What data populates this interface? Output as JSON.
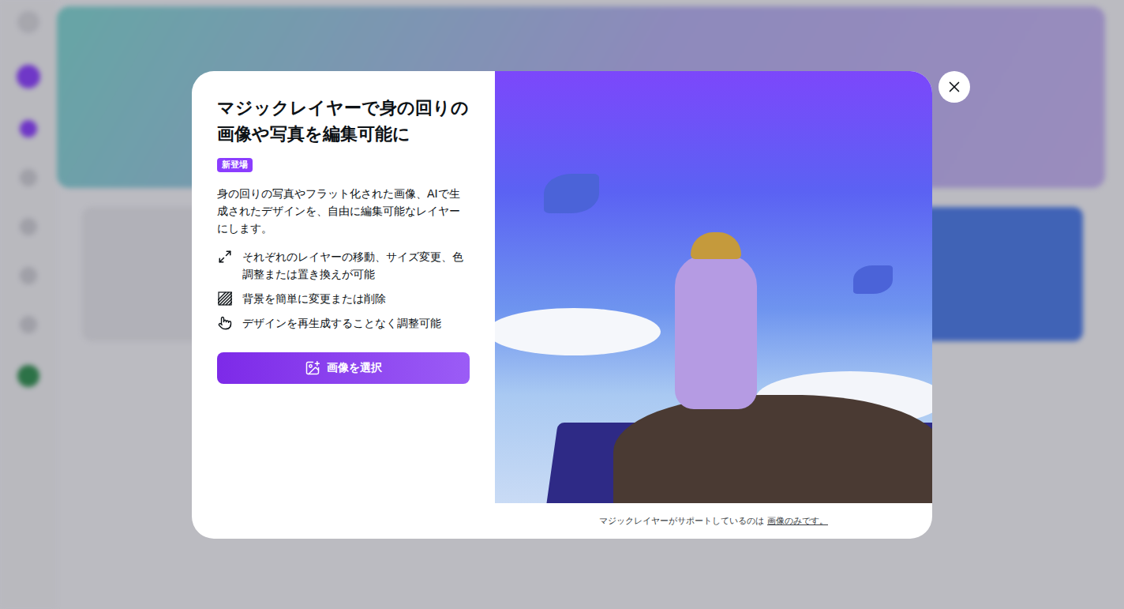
{
  "modal": {
    "title": "マジックレイヤーで身の回りの画像や写真を編集可能に",
    "badge": "新登場",
    "description": "身の回りの写真やフラット化された画像、AIで生成されたデザインを、自由に編集可能なレイヤーにします。",
    "features": [
      {
        "kind": "resize",
        "text": "それぞれのレイヤーの移動、サイズ変更、色調整または置き換えが可能"
      },
      {
        "kind": "background",
        "text": "背景を簡単に変更または削除"
      },
      {
        "kind": "adjust",
        "text": "デザインを再生成することなく調整可能"
      }
    ],
    "button": "画像を選択",
    "note": {
      "text": "マジックレイヤーがサポートしているのは",
      "link": "画像のみです。"
    }
  }
}
